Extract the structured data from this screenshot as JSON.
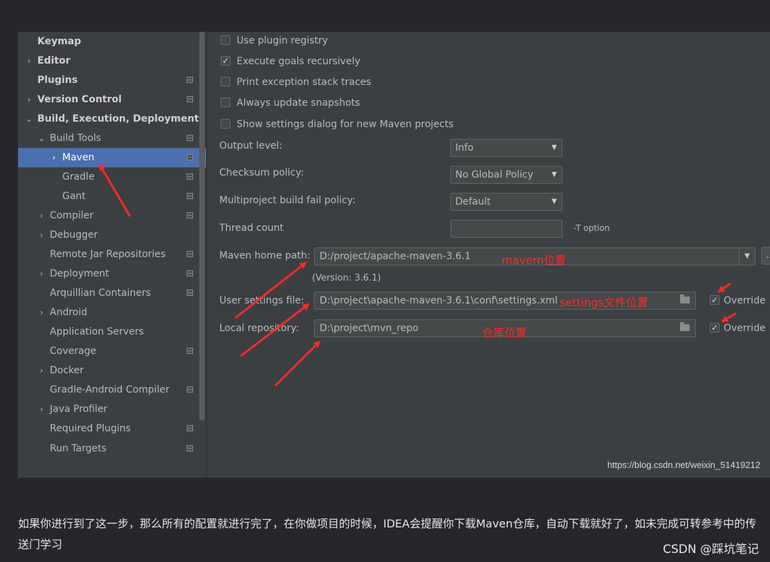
{
  "sidebar": {
    "items": [
      {
        "label": "Keymap"
      },
      {
        "label": "Editor"
      },
      {
        "label": "Plugins"
      },
      {
        "label": "Version Control"
      },
      {
        "label": "Build, Execution, Deployment"
      },
      {
        "label": "Build Tools"
      },
      {
        "label": "Maven"
      },
      {
        "label": "Gradle"
      },
      {
        "label": "Gant"
      },
      {
        "label": "Compiler"
      },
      {
        "label": "Debugger"
      },
      {
        "label": "Remote Jar Repositories"
      },
      {
        "label": "Deployment"
      },
      {
        "label": "Arquillian Containers"
      },
      {
        "label": "Android"
      },
      {
        "label": "Application Servers"
      },
      {
        "label": "Coverage"
      },
      {
        "label": "Docker"
      },
      {
        "label": "Gradle-Android Compiler"
      },
      {
        "label": "Java Profiler"
      },
      {
        "label": "Required Plugins"
      },
      {
        "label": "Run Targets"
      }
    ],
    "selected": "Maven"
  },
  "maven": {
    "checkboxes": [
      {
        "label": "Use plugin registry",
        "checked": false
      },
      {
        "label": "Execute goals recursively",
        "checked": true
      },
      {
        "label": "Print exception stack traces",
        "checked": false
      },
      {
        "label": "Always update snapshots",
        "checked": false
      },
      {
        "label": "Show settings dialog for new Maven projects",
        "checked": false
      }
    ],
    "output_level": {
      "label": "Output level:",
      "value": "Info"
    },
    "checksum_policy": {
      "label": "Checksum policy:",
      "value": "No Global Policy"
    },
    "fail_policy": {
      "label": "Multiproject build fail policy:",
      "value": "Default"
    },
    "thread_count": {
      "label": "Thread count",
      "value": "",
      "hint": "-T option"
    },
    "home_path": {
      "label": "Maven home path:",
      "value": "D:/project/apache-maven-3.6.1",
      "browse": "..."
    },
    "version": "(Version: 3.6.1)",
    "user_settings": {
      "label": "User settings file:",
      "value": "D:\\project\\apache-maven-3.6.1\\conf\\settings.xml",
      "override_label": "Override",
      "override": true
    },
    "local_repo": {
      "label": "Local repository:",
      "value": "D:\\project\\mvn_repo",
      "override_label": "Override",
      "override": true
    }
  },
  "annotations": {
    "home": "mavern位置",
    "settings": "settings文件位置",
    "repo": "仓库位置"
  },
  "watermark": "https://blog.csdn.net/weixin_51419212",
  "article": {
    "text": "如果你进行到了这一步，那么所有的配置就进行完了，在你做项目的时候，IDEA会提醒你下载Maven仓库，自动下载就好了，如未完成可转参考中的传送门学习",
    "brand": "CSDN @踩坑笔记"
  },
  "colors": {
    "panel": "#3c3f41",
    "selection": "#4b6eaf",
    "annotation": "#ff2b2b",
    "page": "#25272c"
  }
}
